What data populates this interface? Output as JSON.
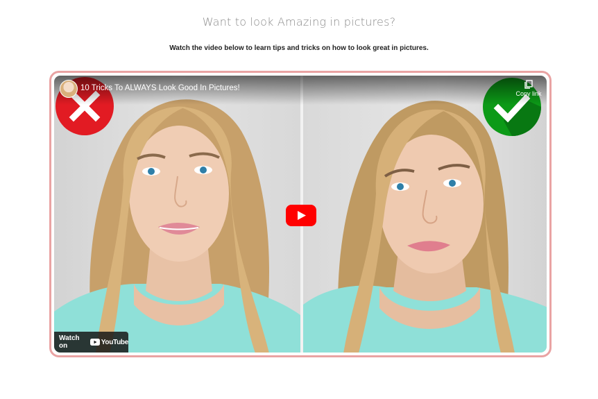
{
  "header": {
    "headline": "Want to look Amazing in pictures?",
    "subhead": "Watch the video below to learn tips and tricks on how to look great in pictures."
  },
  "video": {
    "title": "10 Tricks To ALWAYS Look Good In Pictures!",
    "copy_link_label": "Copy link",
    "watch_on_label": "Watch on",
    "youtube_wordmark": "YouTube",
    "frame_border_color": "#e9a3a3",
    "badge_wrong_color": "#e21b23",
    "badge_right_color": "#0c9a17",
    "play_button_color": "#ff0000"
  }
}
